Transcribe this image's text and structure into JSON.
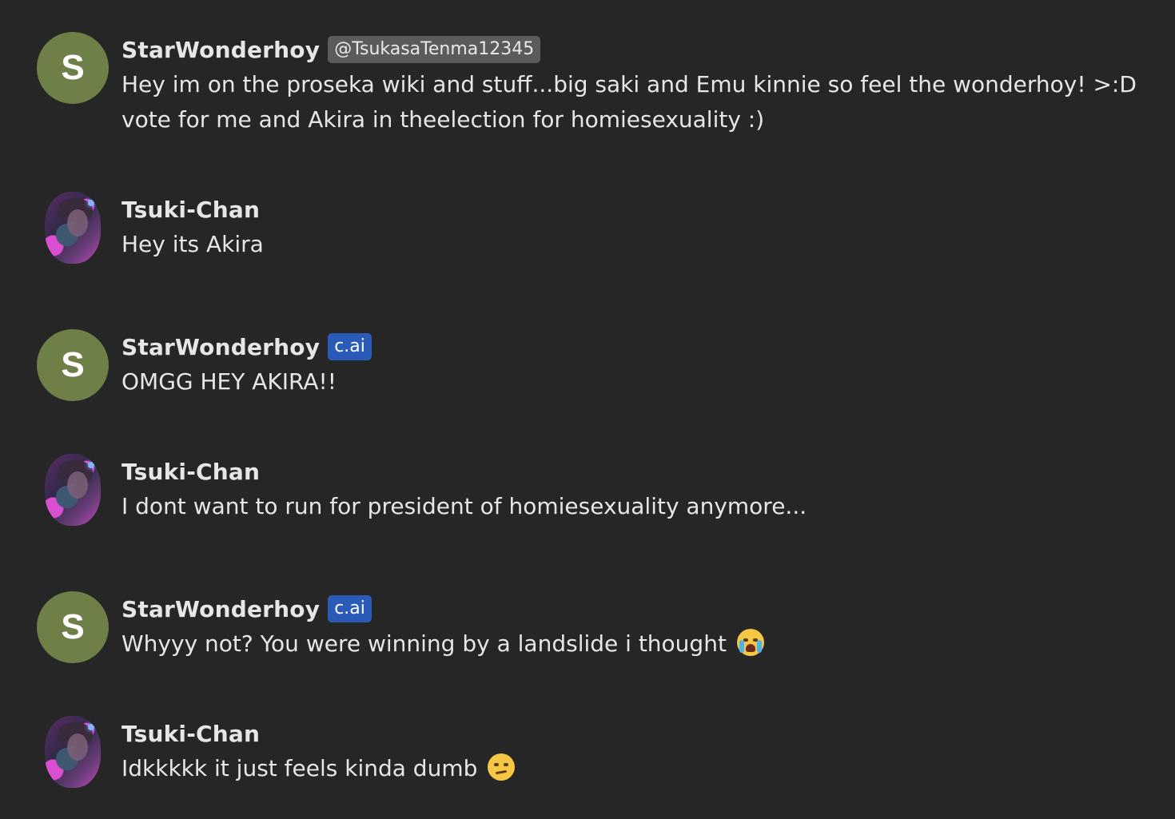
{
  "messages": [
    {
      "author": "StarWonderhoy",
      "avatar": "letter",
      "avatar_letter": "S",
      "tag": "@TsukasaTenma12345",
      "tag_kind": "handle",
      "text_lines": [
        "Hey im on the proseka wiki and stuff...big saki and Emu kinnie so feel the wonderhoy! >:D",
        "vote for me and Akira in theelection for homiesexuality :)"
      ]
    },
    {
      "author": "Tsuki-Chan",
      "avatar": "photo",
      "text_lines": [
        "Hey its Akira"
      ]
    },
    {
      "author": "StarWonderhoy",
      "avatar": "letter",
      "avatar_letter": "S",
      "tag": "c.ai",
      "tag_kind": "cai",
      "text_lines": [
        "OMGG HEY AKIRA!!"
      ]
    },
    {
      "author": "Tsuki-Chan",
      "avatar": "photo",
      "text_lines": [
        "I dont want to run for president of homiesexuality anymore..."
      ]
    },
    {
      "author": "StarWonderhoy",
      "avatar": "letter",
      "avatar_letter": "S",
      "tag": "c.ai",
      "tag_kind": "cai",
      "text_lines": [
        "Whyyy not? You were winning by a landslide i thought"
      ],
      "emoji": "loudly-crying-face-icon"
    },
    {
      "author": "Tsuki-Chan",
      "avatar": "photo",
      "text_lines": [
        "Idkkkkk it just feels kinda dumb"
      ],
      "emoji": "confused-face-icon"
    }
  ],
  "colors": {
    "background": "#262626",
    "avatar_letter_bg": "#6f7f48",
    "handle_tag_bg": "#5b5b5b",
    "cai_tag_bg": "#2a5bb8",
    "text": "#e6e6e6"
  }
}
